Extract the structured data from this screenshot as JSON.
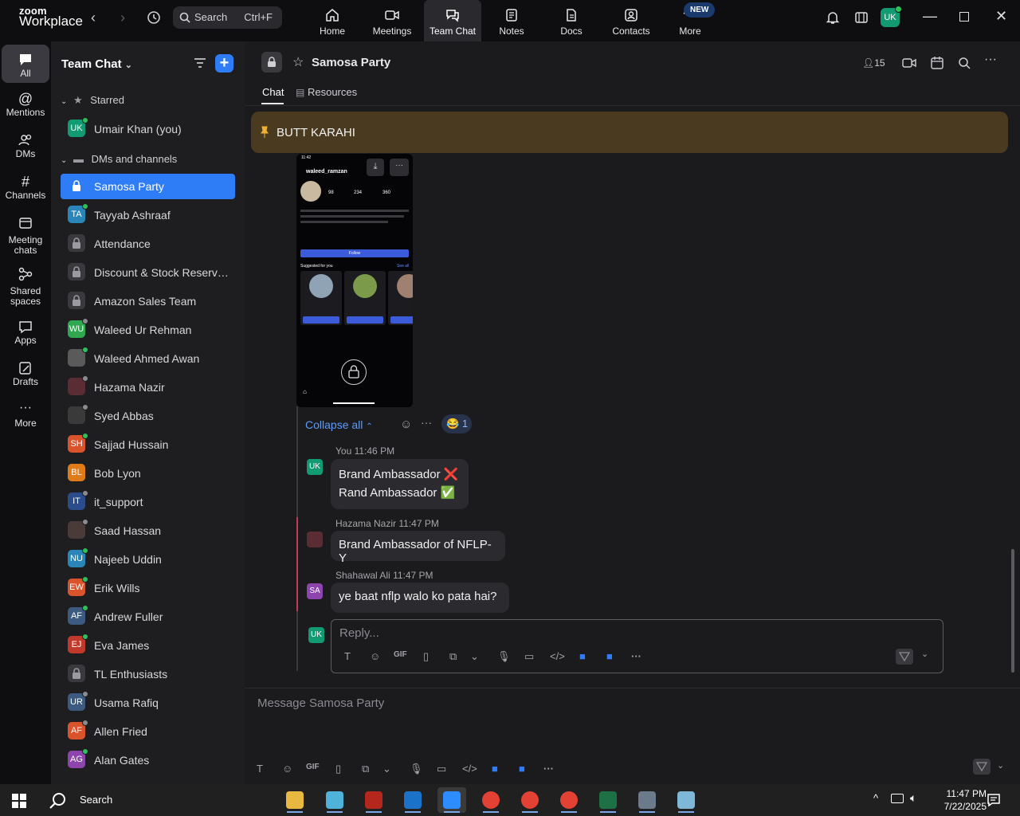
{
  "app": {
    "logo_top": "zoom",
    "logo_bottom": "Workplace"
  },
  "search": {
    "label": "Search",
    "shortcut": "Ctrl+F"
  },
  "nav_tabs": [
    {
      "label": "Home"
    },
    {
      "label": "Meetings"
    },
    {
      "label": "Team Chat"
    },
    {
      "label": "Notes"
    },
    {
      "label": "Docs"
    },
    {
      "label": "Contacts"
    },
    {
      "label": "More"
    }
  ],
  "new_badge": "NEW",
  "user_avatar": "UK",
  "rail": [
    {
      "label": "All"
    },
    {
      "label": "Mentions"
    },
    {
      "label": "DMs"
    },
    {
      "label": "Channels"
    },
    {
      "label": "Meeting chats"
    },
    {
      "label": "Shared spaces"
    },
    {
      "label": "Apps"
    },
    {
      "label": "Drafts"
    },
    {
      "label": "More"
    }
  ],
  "sidebar": {
    "title": "Team Chat",
    "starred_header": "Starred",
    "dms_header": "DMs and channels",
    "starred": [
      {
        "initials": "UK",
        "name": "Umair Khan (you)",
        "color": "#129a73",
        "status": "online"
      }
    ],
    "items": [
      {
        "initials": "",
        "name": "Samosa Party",
        "type": "channel",
        "selected": true
      },
      {
        "initials": "TA",
        "name": "Tayyab Ashraaf",
        "color": "#2a86b8",
        "status": "online"
      },
      {
        "initials": "",
        "name": "Attendance",
        "type": "channel"
      },
      {
        "initials": "",
        "name": "Discount & Stock Reservati...",
        "type": "channel"
      },
      {
        "initials": "",
        "name": "Amazon Sales Team",
        "type": "channel"
      },
      {
        "initials": "WU",
        "name": "Waleed Ur Rehman",
        "color": "#2fa84f",
        "status": "away"
      },
      {
        "initials": "",
        "name": "Waleed Ahmed Awan",
        "color": "#5a5a5a",
        "status": "online",
        "photo": true
      },
      {
        "initials": "",
        "name": "Hazama Nazir",
        "color": "#5a2c34",
        "status": "away",
        "photo": true
      },
      {
        "initials": "",
        "name": "Syed Abbas",
        "color": "#3a3a3a",
        "status": "away",
        "photo": true
      },
      {
        "initials": "SH",
        "name": "Sajjad Hussain",
        "color": "#d9532c",
        "status": "online"
      },
      {
        "initials": "BL",
        "name": "Bob Lyon",
        "color": "#e07b1a",
        "status": "none"
      },
      {
        "initials": "IT",
        "name": "it_support",
        "color": "#2b4b8a",
        "status": "away",
        "photo": true
      },
      {
        "initials": "",
        "name": "Saad Hassan",
        "color": "#4a3a3a",
        "status": "away",
        "photo": true
      },
      {
        "initials": "NU",
        "name": "Najeeb Uddin",
        "color": "#2a86b8",
        "status": "online"
      },
      {
        "initials": "EW",
        "name": "Erik Wills",
        "color": "#d9532c",
        "status": "online"
      },
      {
        "initials": "AF",
        "name": "Andrew Fuller",
        "color": "#3d5a80",
        "status": "online"
      },
      {
        "initials": "EJ",
        "name": "Eva James",
        "color": "#c0392b",
        "status": "online"
      },
      {
        "initials": "",
        "name": "TL Enthusiasts",
        "type": "channel"
      },
      {
        "initials": "UR",
        "name": "Usama Rafiq",
        "color": "#3d5a80",
        "status": "away"
      },
      {
        "initials": "AF",
        "name": "Allen Fried",
        "color": "#d9532c",
        "status": "away"
      },
      {
        "initials": "AG",
        "name": "Alan Gates",
        "color": "#8e44ad",
        "status": "online"
      }
    ]
  },
  "channel": {
    "title": "Samosa Party",
    "members": "15",
    "tabs": [
      {
        "label": "Chat"
      },
      {
        "label": "Resources"
      }
    ],
    "pinned": "BUTT KARAHI"
  },
  "thread": {
    "collapse_label": "Collapse all",
    "reaction_count": "1",
    "messages": [
      {
        "author": "You",
        "time": "11:46 PM",
        "initials": "UK",
        "lines": [
          "Brand Ambassador ❌",
          "Rand Ambassador ✅"
        ]
      },
      {
        "author": "Hazama Nazir",
        "time": "11:47 PM",
        "initials": "",
        "lines": [
          "Brand Ambassador of NFLP-Y"
        ]
      },
      {
        "author": "Shahawal Ali",
        "time": "11:47 PM",
        "initials": "SA",
        "lines": [
          "ye baat nflp walo ko pata hai?"
        ]
      }
    ],
    "reply_placeholder": "Reply..."
  },
  "phone_shot": {
    "handle": "waleed_ramzan",
    "posts": "98",
    "followers": "234",
    "following": "360",
    "button": "Follow",
    "suggest": "Suggested for you",
    "see_all": "See all"
  },
  "composer": {
    "placeholder": "Message Samosa Party"
  },
  "taskbar": {
    "search": "Search",
    "time": "11:47 PM",
    "date": "7/22/2025"
  },
  "colors": {
    "accent": "#2f7df6",
    "pin": "#4a3a20"
  }
}
